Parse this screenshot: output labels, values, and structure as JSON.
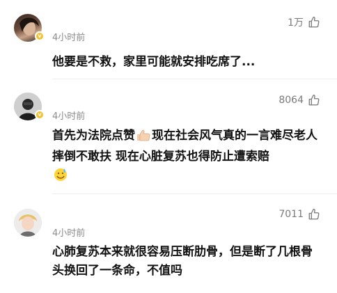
{
  "comments": [
    {
      "time": "4小时前",
      "likes": "1万",
      "text": "他要是不救，家里可能就安排吃席了..."
    },
    {
      "time": "4小时前",
      "likes": "8064",
      "text_part1": "首先为法院点赞",
      "text_part2": "现在社会风气真的一言难尽老人摔倒不敢扶 现在心脏复苏也得防止遭索赔"
    },
    {
      "time": "4小时前",
      "likes": "7011",
      "text": "心肺复苏本来就很容易压断肋骨，但是断了几根骨头换回了一条命，不值吗"
    }
  ],
  "colors": {
    "badge": "#f2c230",
    "meta_text": "#8a8a8a",
    "body_text": "#111111"
  }
}
